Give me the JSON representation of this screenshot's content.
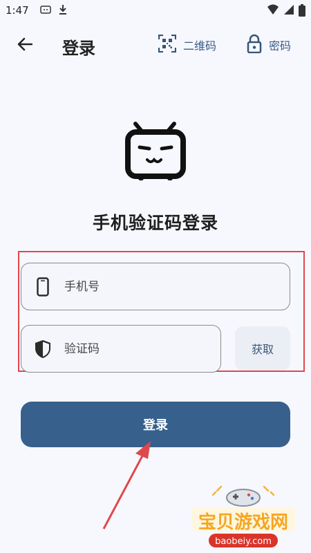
{
  "status_bar": {
    "time": "1:47"
  },
  "app_bar": {
    "title": "登录",
    "qr_label": "二维码",
    "password_label": "密码"
  },
  "heading": "手机验证码登录",
  "phone_field": {
    "placeholder": "手机号",
    "value": ""
  },
  "code_field": {
    "placeholder": "验证码",
    "value": ""
  },
  "get_code_label": "获取",
  "login_label": "登录",
  "watermark": {
    "text": "宝贝游戏网",
    "url_text": "baobeiy.com"
  },
  "colors": {
    "accent": "#37608d",
    "highlight": "#e0474c",
    "background": "#f7f8fe"
  }
}
